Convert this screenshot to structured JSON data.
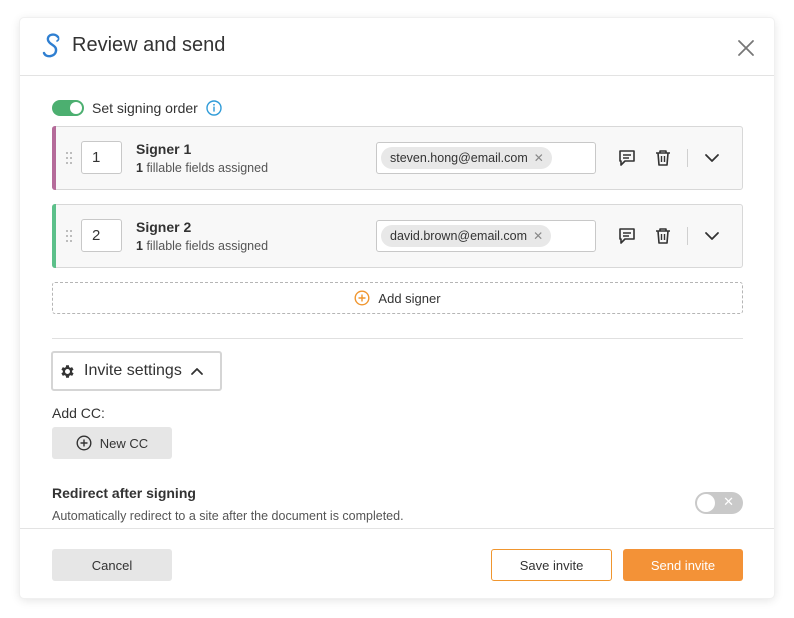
{
  "colors": {
    "accent": "#f39237",
    "toggle_on": "#4caf70",
    "signer1_bar": "#b56b9a",
    "signer2_bar": "#5cc08a",
    "logo": "#2f7fd1"
  },
  "header": {
    "title": "Review and send",
    "logo_icon": "script-s-logo",
    "close_icon": "close-icon"
  },
  "signing_order": {
    "label": "Set signing order",
    "enabled": true,
    "info_icon": "info-icon"
  },
  "signers": [
    {
      "order": "1",
      "name": "Signer 1",
      "fields_count": "1",
      "fields_text": "fillable fields assigned",
      "email": "steven.hong@email.com"
    },
    {
      "order": "2",
      "name": "Signer 2",
      "fields_count": "1",
      "fields_text": "fillable fields assigned",
      "email": "david.brown@email.com"
    }
  ],
  "add_signer": {
    "label": "Add signer",
    "icon": "plus-circle-icon"
  },
  "invite_settings": {
    "label": "Invite settings",
    "icon": "gear-icon",
    "expanded": true
  },
  "cc": {
    "label": "Add CC:",
    "button_label": "New CC"
  },
  "redirect": {
    "title": "Redirect after signing",
    "description": "Automatically redirect to a site after the document is completed.",
    "enabled": false
  },
  "footer": {
    "cancel_label": "Cancel",
    "save_label": "Save invite",
    "send_label": "Send invite"
  }
}
